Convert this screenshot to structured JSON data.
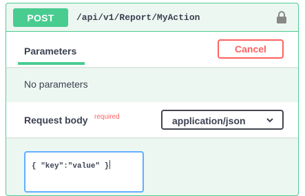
{
  "operation": {
    "method": "POST",
    "path": "/api/v1/Report/MyAction",
    "lock_icon": "lock-icon",
    "accent_color": "#49cc90"
  },
  "parameters": {
    "tab_label": "Parameters",
    "cancel_label": "Cancel",
    "empty_text": "No parameters"
  },
  "request_body": {
    "label": "Request body",
    "required_label": "required",
    "content_type": "application/json",
    "editor_value": "{ \"key\":\"value\" }"
  }
}
